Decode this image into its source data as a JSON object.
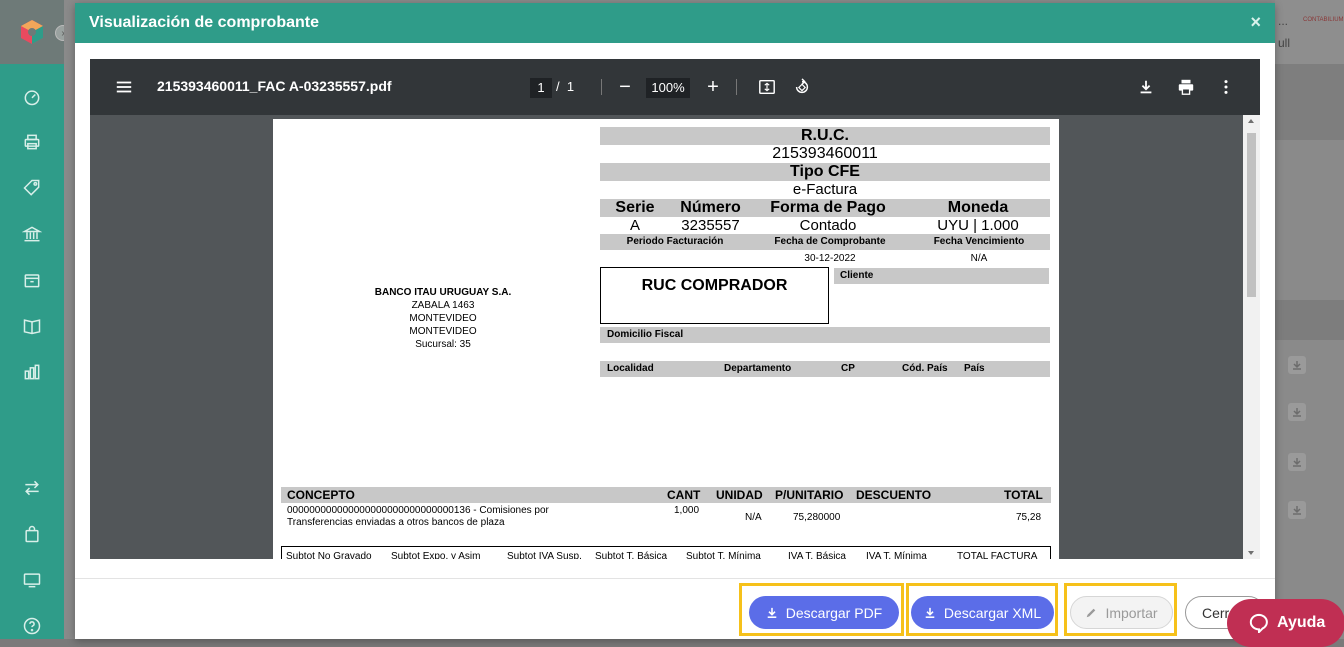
{
  "modal": {
    "title": "Visualización de comprobante",
    "close_icon": "×"
  },
  "viewer": {
    "file_name": "215393460011_FAC A-03235557.pdf",
    "page_current": "1",
    "page_sep": "/",
    "page_total": "1",
    "zoom": "100%",
    "zoom_out": "−",
    "zoom_in": "+"
  },
  "invoice": {
    "ruc_label": "R.U.C.",
    "ruc_value": "215393460011",
    "tipo_label": "Tipo CFE",
    "tipo_value": "e-Factura",
    "serie_label": "Serie",
    "numero_label": "Número",
    "forma_label": "Forma de Pago",
    "moneda_label": "Moneda",
    "serie_value": "A",
    "numero_value": "3235557",
    "forma_value": "Contado",
    "moneda_value": "UYU | 1.000",
    "periodo_label": "Periodo Facturación",
    "fecha_comp_label": "Fecha de Comprobante",
    "fecha_venc_label": "Fecha Vencimiento",
    "fecha_comp_value": "30-12-2022",
    "fecha_venc_value": "N/A",
    "ruc_comprador": "RUC COMPRADOR",
    "cliente_label": "Cliente",
    "domicilio_label": "Domicilio Fiscal",
    "localidad_label": "Localidad",
    "departamento_label": "Departamento",
    "cp_label": "CP",
    "cod_pais_label": "Cód. País",
    "pais_label": "País",
    "sender": {
      "name": "BANCO ITAU URUGUAY S.A.",
      "address": "ZABALA 1463",
      "city1": "MONTEVIDEO",
      "city2": "MONTEVIDEO",
      "sucursal": "Sucursal: 35"
    },
    "table_headers": {
      "concepto": "CONCEPTO",
      "cant": "CANT",
      "unidad": "UNIDAD",
      "punitario": "P/UNITARIO",
      "descuento": "DESCUENTO",
      "total": "TOTAL"
    },
    "line_item": {
      "concepto": "000000000000000000000000000000136 - Comisiones por Transferencias enviadas a otros bancos de plaza",
      "cant": "1,000",
      "unidad": "N/A",
      "punitario": "75,280000",
      "total": "75,28"
    },
    "totals_headers": [
      "Subtot No Gravado",
      "Subtot Expo. y Asim",
      "Subtot IVA Susp.",
      "Subtot T. Básica",
      "Subtot T. Mínima",
      "IVA T. Básica",
      "IVA T. Mínima",
      "TOTAL FACTURA"
    ]
  },
  "footer": {
    "descargar_pdf": "Descargar PDF",
    "descargar_xml": "Descargar XML",
    "importar": "Importar",
    "cerrar": "Cerr"
  },
  "ayuda": "Ayuda",
  "background": {
    "text1": "...",
    "text2": "ull",
    "brand": "CONTABILIUM"
  },
  "colors": {
    "teal": "#2f9c89",
    "primary": "#5b6de8",
    "highlight": "#f6c11a",
    "help": "#c02f53"
  }
}
